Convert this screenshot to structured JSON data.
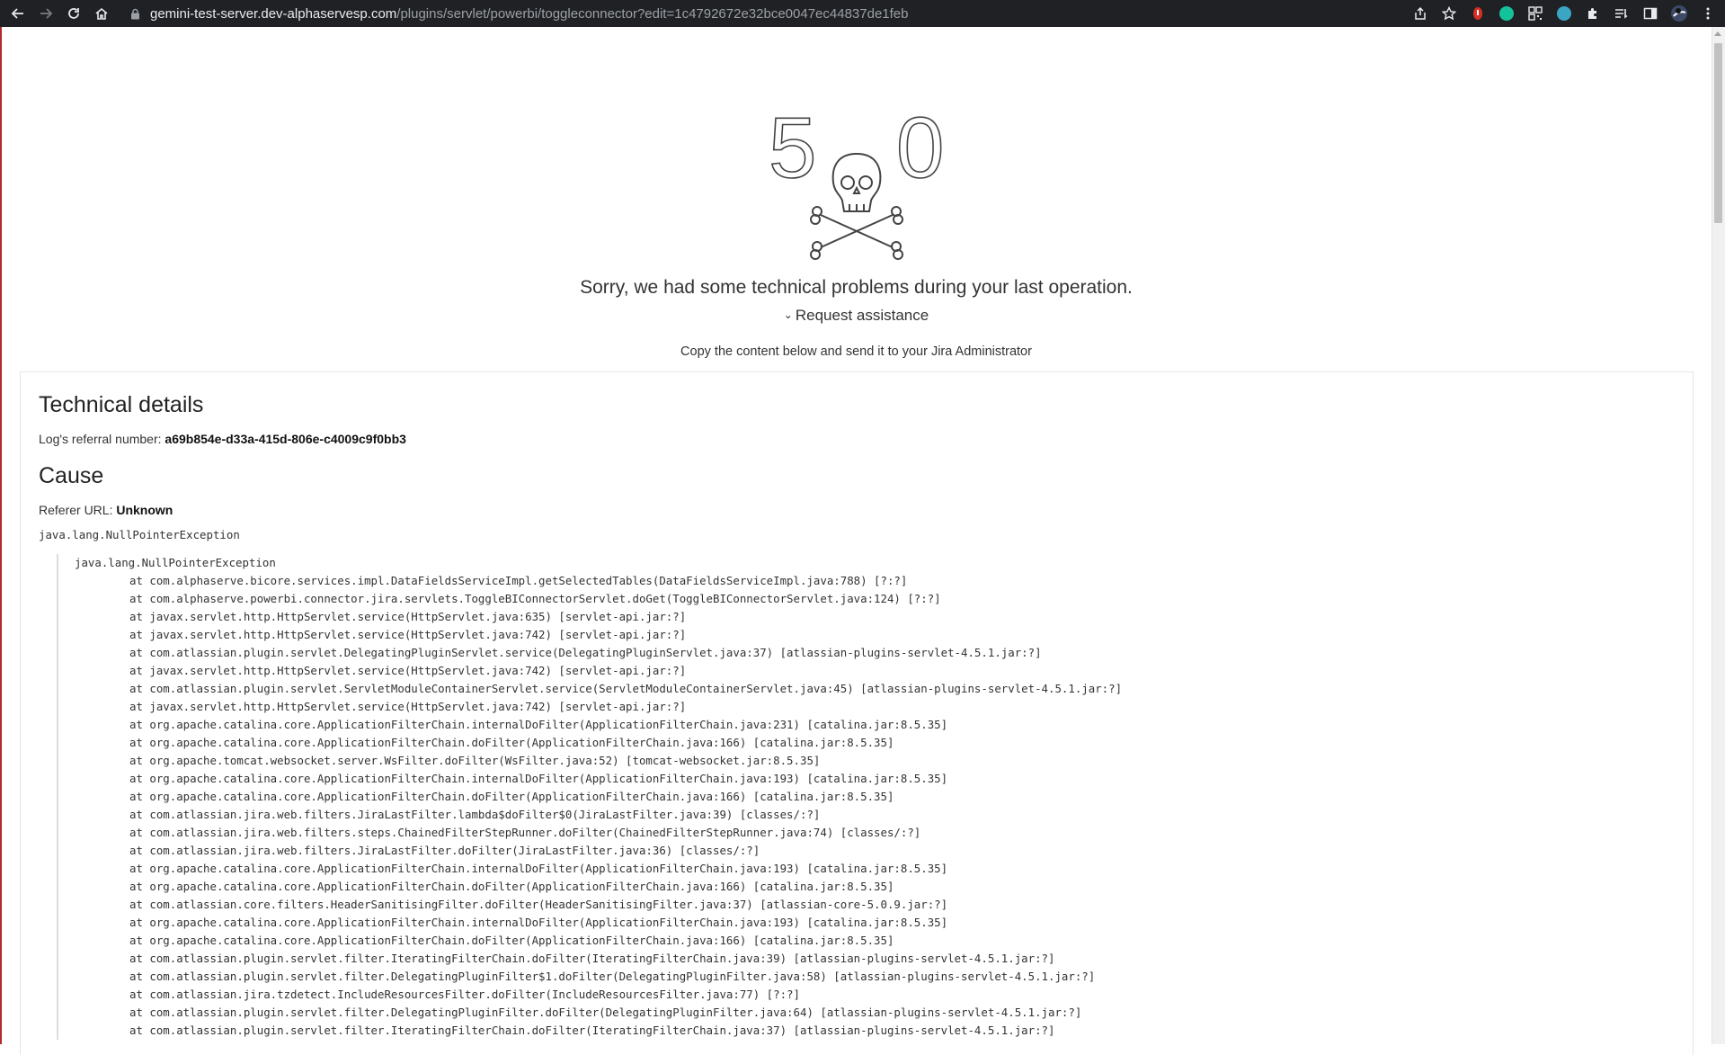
{
  "browser": {
    "url_host": "gemini-test-server.dev-alphaservesp.com",
    "url_path": "/plugins/servlet/powerbi/toggleconnector?edit=1c4792672e32bce0047ec44837de1feb",
    "icons": [
      "back-icon",
      "forward-icon",
      "reload-icon",
      "home-icon",
      "lock-icon",
      "share-icon",
      "bookmark-star-icon",
      "extension-icon",
      "grammarly-icon",
      "qr-icon",
      "extension-m-icon",
      "puzzle-extensions-icon",
      "reading-list-icon",
      "side-panel-icon",
      "profile-avatar",
      "menu-kebab-icon"
    ]
  },
  "error": {
    "digit_left": "5",
    "digit_right": "0",
    "message": "Sorry, we had some technical problems during your last operation.",
    "request_assistance": "Request assistance",
    "copy_note": "Copy the content below and send it to your Jira Administrator"
  },
  "details": {
    "title": "Technical details",
    "log_label": "Log's referral number:",
    "log_value": "a69b854e-d33a-415d-806e-c4009c9f0bb3",
    "cause_title": "Cause",
    "referer_label": "Referer URL:",
    "referer_value": "Unknown",
    "exception": "java.lang.NullPointerException",
    "trace_head": "java.lang.NullPointerException",
    "trace": [
      "at com.alphaserve.bicore.services.impl.DataFieldsServiceImpl.getSelectedTables(DataFieldsServiceImpl.java:788) [?:?]",
      "at com.alphaserve.powerbi.connector.jira.servlets.ToggleBIConnectorServlet.doGet(ToggleBIConnectorServlet.java:124) [?:?]",
      "at javax.servlet.http.HttpServlet.service(HttpServlet.java:635) [servlet-api.jar:?]",
      "at javax.servlet.http.HttpServlet.service(HttpServlet.java:742) [servlet-api.jar:?]",
      "at com.atlassian.plugin.servlet.DelegatingPluginServlet.service(DelegatingPluginServlet.java:37) [atlassian-plugins-servlet-4.5.1.jar:?]",
      "at javax.servlet.http.HttpServlet.service(HttpServlet.java:742) [servlet-api.jar:?]",
      "at com.atlassian.plugin.servlet.ServletModuleContainerServlet.service(ServletModuleContainerServlet.java:45) [atlassian-plugins-servlet-4.5.1.jar:?]",
      "at javax.servlet.http.HttpServlet.service(HttpServlet.java:742) [servlet-api.jar:?]",
      "at org.apache.catalina.core.ApplicationFilterChain.internalDoFilter(ApplicationFilterChain.java:231) [catalina.jar:8.5.35]",
      "at org.apache.catalina.core.ApplicationFilterChain.doFilter(ApplicationFilterChain.java:166) [catalina.jar:8.5.35]",
      "at org.apache.tomcat.websocket.server.WsFilter.doFilter(WsFilter.java:52) [tomcat-websocket.jar:8.5.35]",
      "at org.apache.catalina.core.ApplicationFilterChain.internalDoFilter(ApplicationFilterChain.java:193) [catalina.jar:8.5.35]",
      "at org.apache.catalina.core.ApplicationFilterChain.doFilter(ApplicationFilterChain.java:166) [catalina.jar:8.5.35]",
      "at com.atlassian.jira.web.filters.JiraLastFilter.lambda$doFilter$0(JiraLastFilter.java:39) [classes/:?]",
      "at com.atlassian.jira.web.filters.steps.ChainedFilterStepRunner.doFilter(ChainedFilterStepRunner.java:74) [classes/:?]",
      "at com.atlassian.jira.web.filters.JiraLastFilter.doFilter(JiraLastFilter.java:36) [classes/:?]",
      "at org.apache.catalina.core.ApplicationFilterChain.internalDoFilter(ApplicationFilterChain.java:193) [catalina.jar:8.5.35]",
      "at org.apache.catalina.core.ApplicationFilterChain.doFilter(ApplicationFilterChain.java:166) [catalina.jar:8.5.35]",
      "at com.atlassian.core.filters.HeaderSanitisingFilter.doFilter(HeaderSanitisingFilter.java:37) [atlassian-core-5.0.9.jar:?]",
      "at org.apache.catalina.core.ApplicationFilterChain.internalDoFilter(ApplicationFilterChain.java:193) [catalina.jar:8.5.35]",
      "at org.apache.catalina.core.ApplicationFilterChain.doFilter(ApplicationFilterChain.java:166) [catalina.jar:8.5.35]",
      "at com.atlassian.plugin.servlet.filter.IteratingFilterChain.doFilter(IteratingFilterChain.java:39) [atlassian-plugins-servlet-4.5.1.jar:?]",
      "at com.atlassian.plugin.servlet.filter.DelegatingPluginFilter$1.doFilter(DelegatingPluginFilter.java:58) [atlassian-plugins-servlet-4.5.1.jar:?]",
      "at com.atlassian.jira.tzdetect.IncludeResourcesFilter.doFilter(IncludeResourcesFilter.java:77) [?:?]",
      "at com.atlassian.plugin.servlet.filter.DelegatingPluginFilter.doFilter(DelegatingPluginFilter.java:64) [atlassian-plugins-servlet-4.5.1.jar:?]",
      "at com.atlassian.plugin.servlet.filter.IteratingFilterChain.doFilter(IteratingFilterChain.java:37) [atlassian-plugins-servlet-4.5.1.jar:?]"
    ]
  }
}
